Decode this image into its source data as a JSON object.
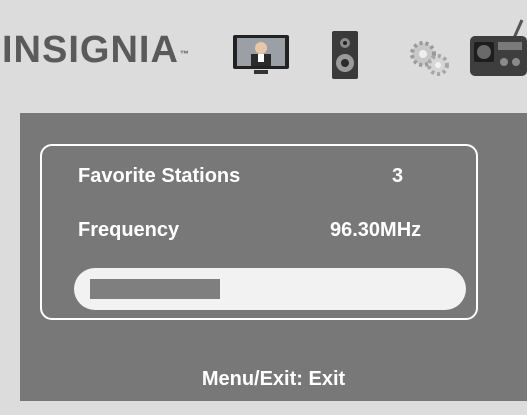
{
  "header": {
    "brand": "INSIGNIA",
    "trademark": "™",
    "icons": [
      "tv-icon",
      "speaker-icon",
      "gear-icon",
      "radio-icon"
    ]
  },
  "station": {
    "favorite_label": "Favorite Stations",
    "favorite_value": "3",
    "frequency_label": "Frequency",
    "frequency_value": "96.30MHz",
    "signal_level": 0.36
  },
  "footer": {
    "hint": "Menu/Exit: Exit"
  },
  "colors": {
    "panel": "#787878",
    "header": "#dcdcdc",
    "text": "#ffffff"
  }
}
